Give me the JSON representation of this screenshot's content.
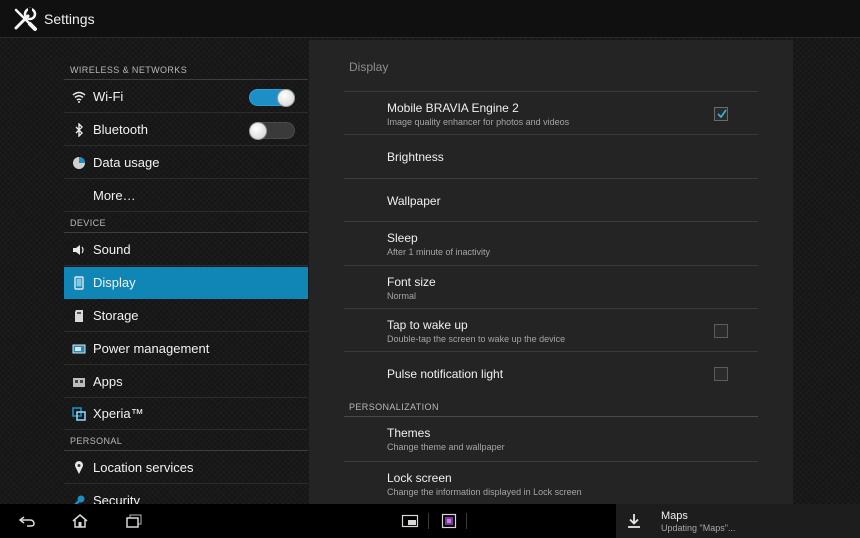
{
  "app": {
    "title": "Settings",
    "icon": "wrench-screwdriver-icon"
  },
  "sidebar": {
    "sections": [
      {
        "label": "WIRELESS & NETWORKS"
      },
      {
        "label": "DEVICE"
      },
      {
        "label": "PERSONAL"
      }
    ],
    "items": [
      {
        "label": "Wi-Fi",
        "icon": "wifi-icon",
        "toggle": "on"
      },
      {
        "label": "Bluetooth",
        "icon": "bluetooth-icon",
        "toggle": "off"
      },
      {
        "label": "Data usage",
        "icon": "data-usage-icon"
      },
      {
        "label": "More…"
      },
      {
        "label": "Sound",
        "icon": "speaker-icon"
      },
      {
        "label": "Display",
        "icon": "display-icon",
        "selected": true
      },
      {
        "label": "Storage",
        "icon": "storage-icon"
      },
      {
        "label": "Power management",
        "icon": "battery-icon"
      },
      {
        "label": "Apps",
        "icon": "apps-icon"
      },
      {
        "label": "Xperia™",
        "icon": "xperia-icon"
      },
      {
        "label": "Location services",
        "icon": "location-icon"
      },
      {
        "label": "Security",
        "icon": "security-icon"
      }
    ]
  },
  "display": {
    "title": "Display",
    "rows": [
      {
        "title": "Mobile BRAVIA Engine 2",
        "subtitle": "Image quality enhancer for photos and videos",
        "checkbox": true
      },
      {
        "title": "Brightness"
      },
      {
        "title": "Wallpaper"
      },
      {
        "title": "Sleep",
        "subtitle": "After 1 minute of inactivity"
      },
      {
        "title": "Font size",
        "subtitle": "Normal"
      },
      {
        "title": "Tap to wake up",
        "subtitle": "Double-tap the screen to wake up the device",
        "checkbox": false
      },
      {
        "title": "Pulse notification light",
        "checkbox": false
      }
    ],
    "personalization_header": "PERSONALIZATION",
    "personalization_rows": [
      {
        "title": "Themes",
        "subtitle": "Change theme and wallpaper"
      },
      {
        "title": "Lock screen",
        "subtitle": "Change the information displayed in Lock screen"
      }
    ]
  },
  "navbar": {
    "back_icon": "back-icon",
    "home_icon": "home-icon",
    "recents_icon": "recent-apps-icon",
    "small_apps_icons": [
      "small-app-window-icon",
      "small-app-gallery-icon"
    ]
  },
  "notification": {
    "title": "Maps",
    "subtitle": "Updating \"Maps\"...",
    "icon": "download-icon"
  },
  "colors": {
    "accent": "#0f86b6",
    "toggle_on": "#1e8fc6",
    "background": "#161616",
    "panel": "#242424"
  }
}
